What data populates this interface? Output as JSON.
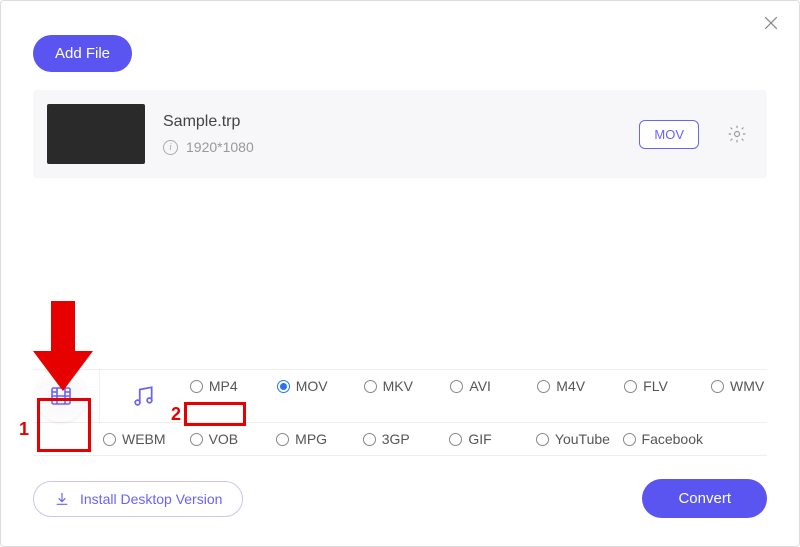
{
  "header": {
    "add_file_label": "Add File"
  },
  "file": {
    "name": "Sample.trp",
    "resolution": "1920*1080",
    "format_tag": "MOV"
  },
  "formats": {
    "row1": [
      "MP4",
      "MOV",
      "MKV",
      "AVI",
      "M4V",
      "FLV",
      "WMV"
    ],
    "row2": [
      "WEBM",
      "VOB",
      "MPG",
      "3GP",
      "GIF",
      "YouTube",
      "Facebook"
    ],
    "selected": "MOV"
  },
  "footer": {
    "install_label": "Install Desktop Version",
    "convert_label": "Convert"
  },
  "annotations": {
    "num1": "1",
    "num2": "2"
  }
}
